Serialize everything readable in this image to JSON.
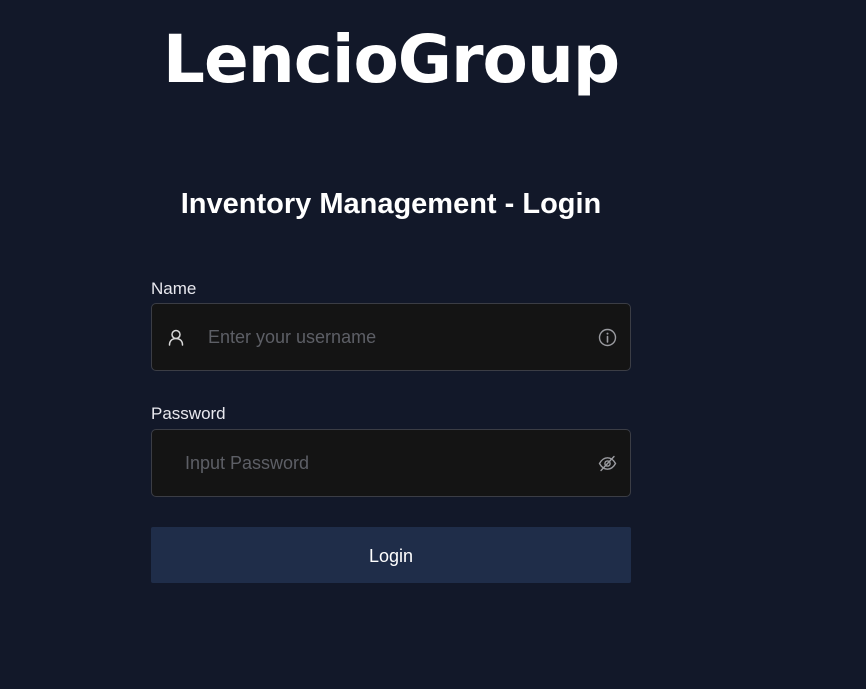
{
  "brand": {
    "logo_text": "LencioGroup"
  },
  "page": {
    "title": "Inventory Management - Login"
  },
  "form": {
    "name": {
      "label": "Name",
      "placeholder": "Enter your username",
      "value": "",
      "prefix_icon": "user-icon",
      "suffix_icon": "info-icon"
    },
    "password": {
      "label": "Password",
      "placeholder": "Input Password",
      "value": "",
      "suffix_icon": "eye-off-icon"
    },
    "submit_label": "Login"
  },
  "colors": {
    "background": "#121829",
    "input_background": "#141414",
    "input_border": "#3b3d45",
    "button_background": "#1f2d49",
    "text": "#ffffff",
    "placeholder": "#5d5f66"
  }
}
